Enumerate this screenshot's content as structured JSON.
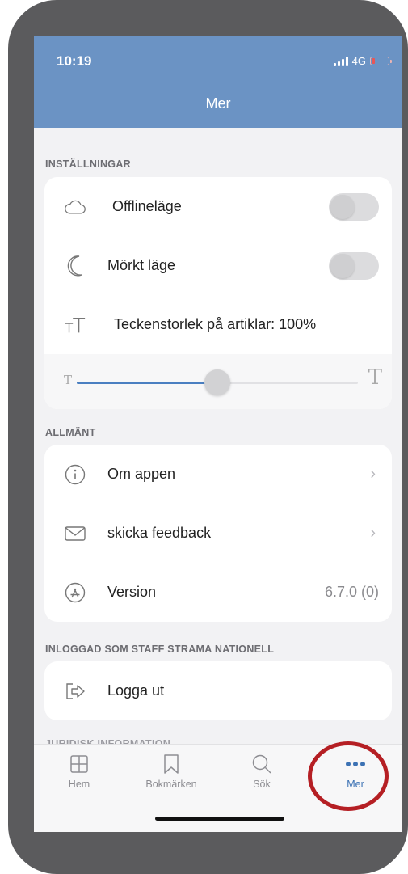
{
  "status": {
    "time": "10:19",
    "network": "4G"
  },
  "nav": {
    "title": "Mer"
  },
  "settings": {
    "label": "INSTÄLLNINGAR",
    "offline": {
      "label": "Offlineläge",
      "enabled": false
    },
    "dark_mode": {
      "label": "Mörkt läge",
      "enabled": false
    },
    "font_size": {
      "label": "Teckenstorlek på artiklar: 100%",
      "slider_fraction": 0.5
    },
    "slider_small_glyph": "T",
    "slider_large_glyph": "T"
  },
  "general": {
    "label": "ALLMÄNT",
    "about": {
      "label": "Om appen"
    },
    "feedback": {
      "label": "skicka feedback"
    },
    "version": {
      "label": "Version",
      "value": "6.7.0 (0)"
    }
  },
  "account": {
    "label": "INLOGGAD SOM STAFF STRAMA NATIONELL",
    "logout": {
      "label": "Logga ut"
    }
  },
  "legal": {
    "label": "JURIDISK INFORMATION"
  },
  "tabs": [
    {
      "label": "Hem",
      "icon": "grid-icon"
    },
    {
      "label": "Bokmärken",
      "icon": "bookmark-icon"
    },
    {
      "label": "Sök",
      "icon": "search-icon"
    },
    {
      "label": "Mer",
      "icon": "more-icon",
      "active": true
    }
  ],
  "colors": {
    "header": "#6b93c4",
    "accent": "#3c72b4",
    "highlight": "#b51f24"
  }
}
